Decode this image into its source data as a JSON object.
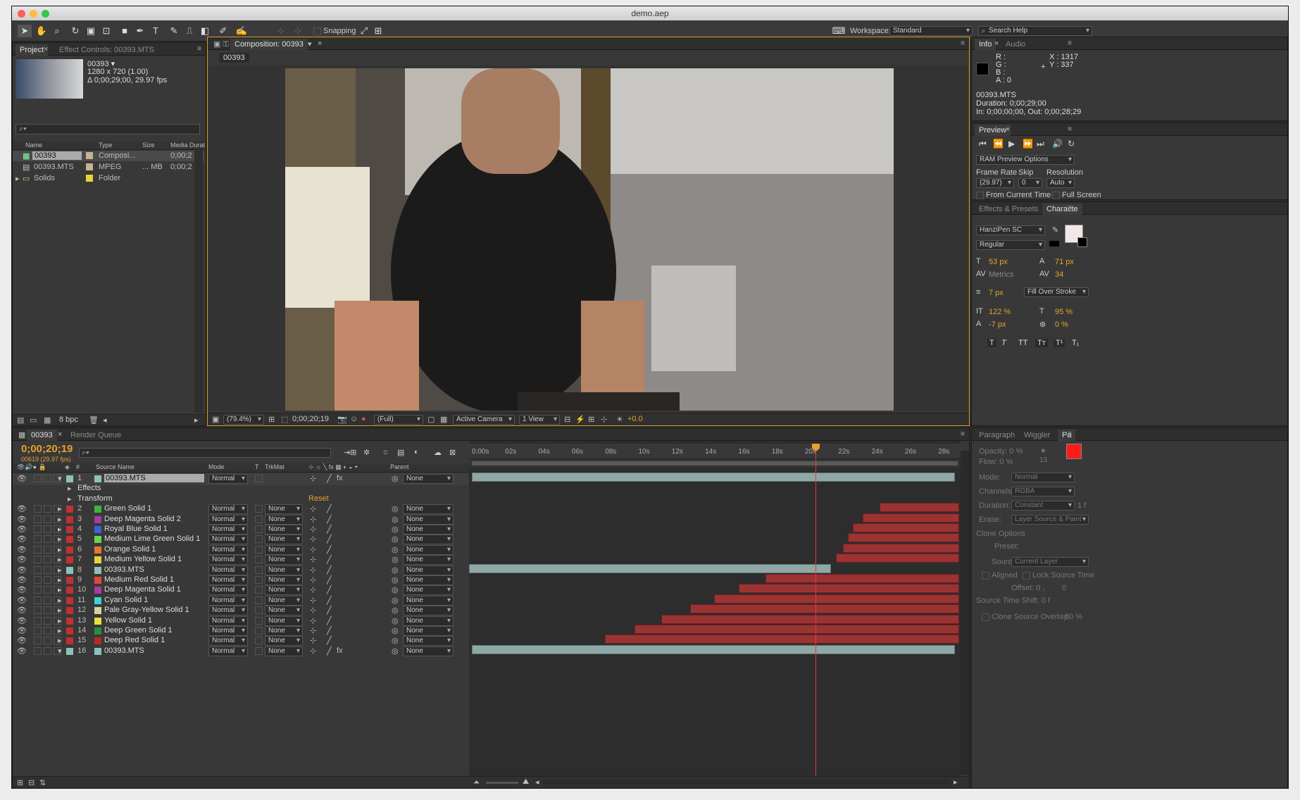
{
  "window": {
    "title": "demo.aep"
  },
  "toolbar": {
    "snapping_label": "Snapping",
    "workspace_label": "Workspace:",
    "workspace_value": "Standard",
    "search_placeholder": "Search Help"
  },
  "project": {
    "tab_label": "Project",
    "effect_controls_tab": "Effect Controls: 00393.MTS",
    "selected_name": "00393 ▾",
    "info_line1": "1280 x 720 (1.00)",
    "info_line2": "Δ 0;00;29;00, 29.97 fps",
    "col_name": "Name",
    "col_type": "Type",
    "col_size": "Size",
    "col_duration": "Media Durat",
    "items": [
      {
        "name": "00393",
        "type": "Composi...",
        "size": "",
        "duration": "0;00;2"
      },
      {
        "name": "00393.MTS",
        "type": "MPEG",
        "size": "... MB",
        "duration": "0;00;2"
      },
      {
        "name": "Solids",
        "type": "Folder",
        "size": "",
        "duration": ""
      }
    ],
    "bpc": "8 bpc"
  },
  "composition": {
    "tab_label": "Composition: 00393",
    "crumb": "00393",
    "zoom": "(79.4%)",
    "timecode": "0;00;20;19",
    "resolution": "(Full)",
    "camera": "Active Camera",
    "views": "1 View",
    "exposure": "+0.0"
  },
  "info": {
    "tab_label": "Info",
    "audio_tab": "Audio",
    "r": "R :",
    "g": "G :",
    "b": "B :",
    "a": "A : 0",
    "x": "X : 1317",
    "y": "Y : 337",
    "file": "00393.MTS",
    "duration": "Duration: 0;00;29;00",
    "inout": "In: 0;00;00;00, Out: 0;00;28;29"
  },
  "preview": {
    "tab_label": "Preview",
    "ram_options": "RAM Preview Options",
    "frame_rate_label": "Frame Rate",
    "skip_label": "Skip",
    "resolution_label": "Resolution",
    "frame_rate": "(29.97)",
    "skip": "0",
    "resolution": "Auto",
    "from_current": "From Current Time",
    "full_screen": "Full Screen"
  },
  "character": {
    "effects_tab": "Effects & Presets",
    "char_tab": "Characte",
    "font": "HanziPen SC",
    "style": "Regular",
    "size": "53 px",
    "leading": "71 px",
    "kerning": "Metrics",
    "tracking": "34",
    "stroke": "7 px",
    "stroke_mode": "Fill Over Stroke",
    "vscale": "122 %",
    "hscale": "95 %",
    "baseline": "-7 px",
    "tsume": "0 %"
  },
  "paint": {
    "paragraph_tab": "Paragraph",
    "wiggler_tab": "Wiggler",
    "pa_tab": "Pa",
    "opacity": "Opacity: 0 %",
    "flow": "Flow: 0 %",
    "brush_size": "13",
    "mode_label": "Mode:",
    "mode": "Normal",
    "channels_label": "Channels:",
    "channels": "RGBA",
    "duration_label": "Duration:",
    "duration": "Constant",
    "duration_f": "1 f",
    "erase_label": "Erase:",
    "erase": "Layer Source & Paint",
    "clone_options": "Clone Options",
    "preset_label": "Preset:",
    "source_label": "Source:",
    "source": "Current Layer",
    "aligned": "Aligned",
    "lock_source": "Lock Source Time",
    "offset": "Offset: 0 ,",
    "offset_y": "0",
    "time_shift": "Source Time Shift: 0 f",
    "overlay": "Clone Source Overlay:",
    "overlay_val": "50 %"
  },
  "timeline": {
    "tab_label": "00393",
    "render_queue_tab": "Render Queue",
    "timecode": "0;00;20;19",
    "frames": "00619 (29.97 fps)",
    "col_num": "#",
    "col_source": "Source Name",
    "col_mode": "Mode",
    "col_t": "T",
    "col_trkmat": "TrkMat",
    "col_parent": "Parent",
    "effects_label": "Effects",
    "transform_label": "Transform",
    "reset_label": "Reset",
    "ruler": [
      "0:00s",
      "02s",
      "04s",
      "06s",
      "08s",
      "10s",
      "12s",
      "14s",
      "16s",
      "18s",
      "20s",
      "22s",
      "24s",
      "26s",
      "28s"
    ],
    "layers": [
      {
        "num": "1",
        "name": "00393.MTS",
        "mode": "Normal",
        "trkmat": "",
        "parent": "None",
        "color": "#8fc1b9"
      },
      {
        "num": "2",
        "name": "Green Solid 1",
        "mode": "Normal",
        "trkmat": "None",
        "parent": "None",
        "color": "#3fb53f"
      },
      {
        "num": "3",
        "name": "Deep Magenta Solid 2",
        "mode": "Normal",
        "trkmat": "None",
        "parent": "None",
        "color": "#a43ca4"
      },
      {
        "num": "4",
        "name": "Royal Blue Solid 1",
        "mode": "Normal",
        "trkmat": "None",
        "parent": "None",
        "color": "#3a63d6"
      },
      {
        "num": "5",
        "name": "Medium Lime Green Solid 1",
        "mode": "Normal",
        "trkmat": "None",
        "parent": "None",
        "color": "#6cd34a"
      },
      {
        "num": "6",
        "name": "Orange Solid 1",
        "mode": "Normal",
        "trkmat": "None",
        "parent": "None",
        "color": "#e8772a"
      },
      {
        "num": "7",
        "name": "Medium Yellow Solid 1",
        "mode": "Normal",
        "trkmat": "None",
        "parent": "None",
        "color": "#e2d43a"
      },
      {
        "num": "8",
        "name": "00393.MTS",
        "mode": "Normal",
        "trkmat": "None",
        "parent": "None",
        "color": "#8fc1b9"
      },
      {
        "num": "9",
        "name": "Medium Red Solid 1",
        "mode": "Normal",
        "trkmat": "None",
        "parent": "None",
        "color": "#e0463a"
      },
      {
        "num": "10",
        "name": "Deep Magenta Solid 1",
        "mode": "Normal",
        "trkmat": "None",
        "parent": "None",
        "color": "#a43ca4"
      },
      {
        "num": "11",
        "name": "Cyan Solid 1",
        "mode": "Normal",
        "trkmat": "None",
        "parent": "None",
        "color": "#3ad3d3"
      },
      {
        "num": "12",
        "name": "Pale Gray-Yellow Solid 1",
        "mode": "Normal",
        "trkmat": "None",
        "parent": "None",
        "color": "#d6d3a0"
      },
      {
        "num": "13",
        "name": "Yellow Solid 1",
        "mode": "Normal",
        "trkmat": "None",
        "parent": "None",
        "color": "#e6e23a"
      },
      {
        "num": "14",
        "name": "Deep Green Solid 1",
        "mode": "Normal",
        "trkmat": "None",
        "parent": "None",
        "color": "#2a8f3a"
      },
      {
        "num": "15",
        "name": "Deep Red Solid 1",
        "mode": "Normal",
        "trkmat": "None",
        "parent": "None",
        "color": "#b52a2a"
      },
      {
        "num": "16",
        "name": "00393.MTS",
        "mode": "Normal",
        "trkmat": "None",
        "parent": "None",
        "color": "#8fc1b9"
      }
    ]
  }
}
